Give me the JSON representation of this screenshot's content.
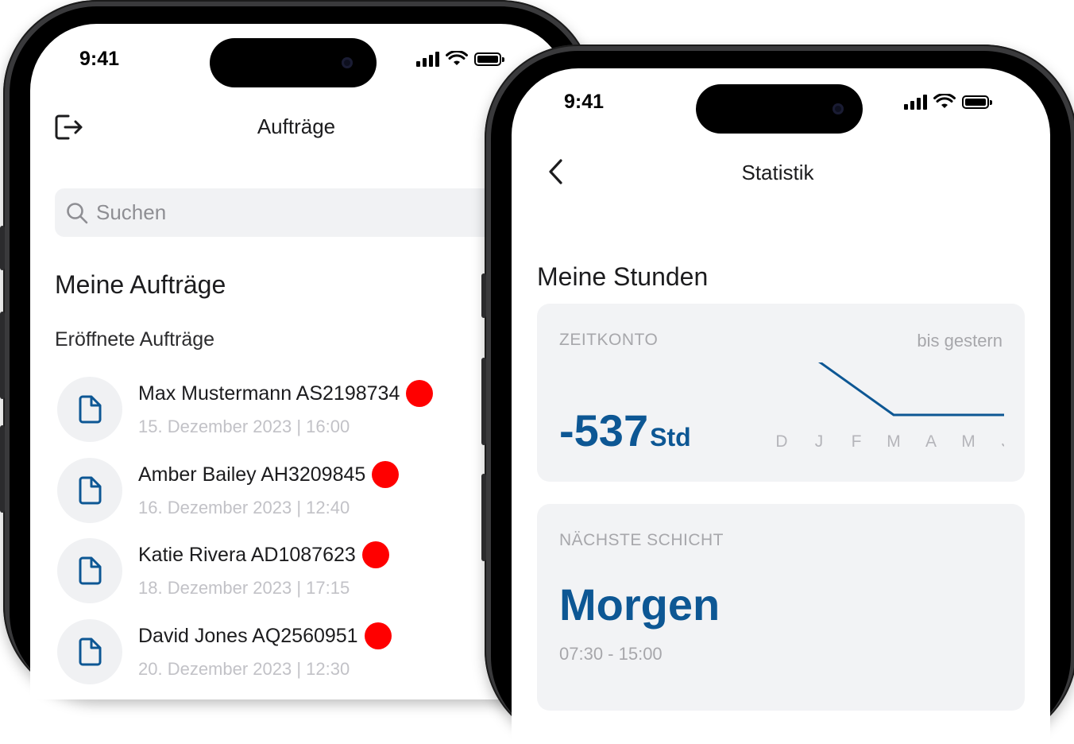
{
  "left_phone": {
    "status_time": "9:41",
    "nav_title": "Aufträge",
    "search_placeholder": "Suchen",
    "section_title": "Meine Aufträge",
    "subsection_title": "Eröffnete Aufträge",
    "orders": [
      {
        "name": "Max Mustermann AS2198734",
        "date": "15. Dezember 2023 | 16:00"
      },
      {
        "name": "Amber Bailey AH3209845",
        "date": "16. Dezember 2023 | 12:40"
      },
      {
        "name": "Katie Rivera AD1087623",
        "date": "18. Dezember 2023 | 17:15"
      },
      {
        "name": "David Jones AQ2560951",
        "date": "20. Dezember 2023 | 12:30"
      }
    ]
  },
  "right_phone": {
    "status_time": "9:41",
    "nav_title": "Statistik",
    "section_title": "Meine Stunden",
    "zeitkonto": {
      "label": "ZEITKONTO",
      "period": "bis gestern",
      "value": "-537",
      "unit": "Std",
      "months": [
        "D",
        "J",
        "F",
        "M",
        "A",
        "M",
        "J"
      ]
    },
    "next_shift": {
      "label": "NÄCHSTE SCHICHT",
      "value": "Morgen",
      "time": "07:30 - 15:00"
    }
  },
  "colors": {
    "accent_blue": "#0d5794",
    "unread_dot": "#ff0000",
    "card_bg": "#f2f3f5"
  },
  "chart_data": {
    "type": "line",
    "categories": [
      "D",
      "J",
      "F",
      "M",
      "A",
      "M",
      "J"
    ],
    "series": [
      {
        "values": [
          null,
          7.8,
          3.9,
          0,
          0,
          0,
          0
        ]
      }
    ],
    "grid": false,
    "axes_visible": false
  }
}
